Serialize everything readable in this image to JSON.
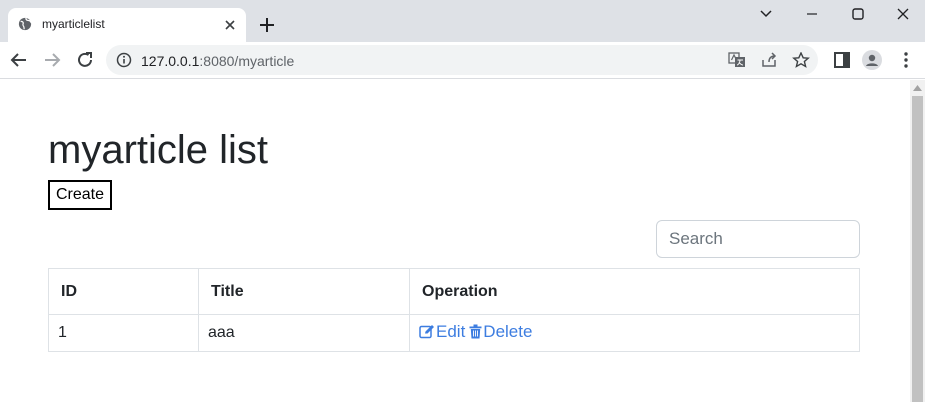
{
  "browser": {
    "tab_title": "myarticlelist",
    "url_host": "127.0.0.1",
    "url_path": ":8080/myarticle",
    "icons": [
      "globe-icon",
      "close-icon",
      "plus-icon",
      "chevron-down-icon",
      "minimize-icon",
      "maximize-icon",
      "close-window-icon",
      "back-icon",
      "forward-icon",
      "reload-icon",
      "info-icon",
      "translate-icon",
      "share-icon",
      "star-icon",
      "side-panel-icon",
      "profile-icon",
      "more-icon"
    ]
  },
  "page": {
    "title": "myarticle list",
    "create_label": "Create",
    "search_placeholder": "Search",
    "table": {
      "columns": [
        "ID",
        "Title",
        "Operation"
      ],
      "rows": [
        {
          "id": "1",
          "title": "aaa",
          "edit": "Edit",
          "delete": "Delete"
        }
      ]
    },
    "link_color": "#3d7de0"
  }
}
